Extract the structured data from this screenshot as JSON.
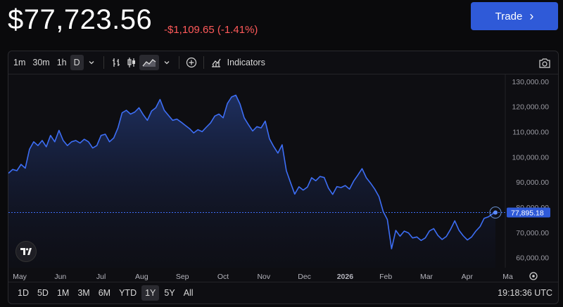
{
  "header": {
    "price": "$77,723.56",
    "change": "-$1,109.65 (-1.41%)",
    "trade_label": "Trade",
    "trade_chevron": "›"
  },
  "toolbar": {
    "intervals": [
      "1m",
      "30m",
      "1h",
      "D"
    ],
    "active_interval": "D",
    "indicators_label": "Indicators",
    "icons": [
      "bar-chart-icon",
      "candlestick-icon",
      "area-chart-icon",
      "chevron-down-icon",
      "add-circle-icon",
      "indicators-icon",
      "camera-icon"
    ]
  },
  "ranges": {
    "items": [
      "1D",
      "5D",
      "1M",
      "3M",
      "6M",
      "YTD",
      "1Y",
      "5Y",
      "All"
    ],
    "active": "1Y"
  },
  "clock": "19:18:36 UTC",
  "last_price_label": "77,895.18",
  "colors": {
    "line": "#3d6ef5",
    "negative": "#ff5a5a",
    "trade_button": "#2f5ad8",
    "price_tag": "#2f5ad8"
  },
  "chart_data": {
    "type": "area",
    "x_tick_labels": [
      "May",
      "Jun",
      "Jul",
      "Aug",
      "Sep",
      "Oct",
      "Nov",
      "Dec",
      "2026",
      "Feb",
      "Mar",
      "Apr",
      "Ma"
    ],
    "y_tick_labels": [
      "130,000.00",
      "120,000.00",
      "110,000.00",
      "100,000.00",
      "90,000.00",
      "80,000.00",
      "70,000.00",
      "60,000.00"
    ],
    "ylim": [
      56000,
      133000
    ],
    "last_value": 77895.18,
    "points": [
      [
        0,
        93500
      ],
      [
        3,
        95000
      ],
      [
        6,
        94500
      ],
      [
        9,
        97000
      ],
      [
        12,
        95500
      ],
      [
        15,
        103000
      ],
      [
        18,
        106000
      ],
      [
        21,
        104500
      ],
      [
        24,
        106500
      ],
      [
        27,
        104000
      ],
      [
        30,
        108500
      ],
      [
        33,
        106000
      ],
      [
        36,
        110500
      ],
      [
        39,
        106500
      ],
      [
        42,
        104500
      ],
      [
        45,
        106000
      ],
      [
        48,
        106500
      ],
      [
        51,
        105500
      ],
      [
        54,
        107000
      ],
      [
        57,
        106000
      ],
      [
        60,
        103500
      ],
      [
        63,
        104500
      ],
      [
        66,
        108500
      ],
      [
        69,
        109000
      ],
      [
        72,
        106000
      ],
      [
        75,
        107500
      ],
      [
        78,
        111500
      ],
      [
        81,
        117500
      ],
      [
        84,
        118500
      ],
      [
        87,
        117000
      ],
      [
        90,
        117800
      ],
      [
        93,
        119500
      ],
      [
        96,
        116800
      ],
      [
        99,
        114500
      ],
      [
        102,
        118200
      ],
      [
        105,
        119500
      ],
      [
        108,
        122800
      ],
      [
        111,
        118500
      ],
      [
        114,
        116500
      ],
      [
        117,
        114500
      ],
      [
        120,
        115000
      ],
      [
        123,
        113800
      ],
      [
        126,
        112500
      ],
      [
        129,
        111200
      ],
      [
        132,
        109500
      ],
      [
        135,
        110800
      ],
      [
        138,
        110000
      ],
      [
        141,
        111800
      ],
      [
        144,
        113500
      ],
      [
        147,
        116200
      ],
      [
        150,
        117000
      ],
      [
        153,
        115500
      ],
      [
        156,
        121200
      ],
      [
        159,
        123800
      ],
      [
        162,
        124500
      ],
      [
        165,
        121000
      ],
      [
        168,
        115500
      ],
      [
        171,
        112800
      ],
      [
        174,
        110300
      ],
      [
        177,
        112000
      ],
      [
        180,
        111500
      ],
      [
        183,
        114200
      ],
      [
        186,
        107200
      ],
      [
        189,
        104100
      ],
      [
        192,
        101500
      ],
      [
        195,
        104800
      ],
      [
        198,
        94500
      ],
      [
        201,
        89800
      ],
      [
        204,
        85200
      ],
      [
        207,
        88100
      ],
      [
        210,
        86800
      ],
      [
        213,
        88000
      ],
      [
        216,
        91700
      ],
      [
        219,
        90500
      ],
      [
        222,
        92200
      ],
      [
        225,
        91800
      ],
      [
        228,
        87600
      ],
      [
        231,
        85100
      ],
      [
        234,
        88200
      ],
      [
        237,
        87800
      ],
      [
        240,
        88600
      ],
      [
        243,
        87200
      ],
      [
        246,
        90400
      ],
      [
        249,
        92800
      ],
      [
        252,
        95300
      ],
      [
        255,
        91700
      ],
      [
        258,
        89600
      ],
      [
        261,
        87200
      ],
      [
        264,
        84200
      ],
      [
        267,
        78300
      ],
      [
        270,
        75100
      ],
      [
        273,
        63500
      ],
      [
        276,
        70800
      ],
      [
        279,
        68500
      ],
      [
        282,
        70500
      ],
      [
        285,
        69800
      ],
      [
        288,
        67800
      ],
      [
        291,
        68200
      ],
      [
        294,
        66800
      ],
      [
        297,
        67800
      ],
      [
        300,
        70600
      ],
      [
        303,
        71500
      ],
      [
        306,
        68800
      ],
      [
        309,
        67200
      ],
      [
        312,
        68400
      ],
      [
        315,
        71200
      ],
      [
        318,
        74600
      ],
      [
        321,
        70900
      ],
      [
        324,
        68700
      ],
      [
        327,
        67000
      ],
      [
        330,
        68200
      ],
      [
        333,
        70500
      ],
      [
        336,
        72300
      ],
      [
        339,
        75600
      ],
      [
        342,
        76200
      ],
      [
        345,
        77400
      ],
      [
        347,
        77895.18
      ]
    ]
  }
}
